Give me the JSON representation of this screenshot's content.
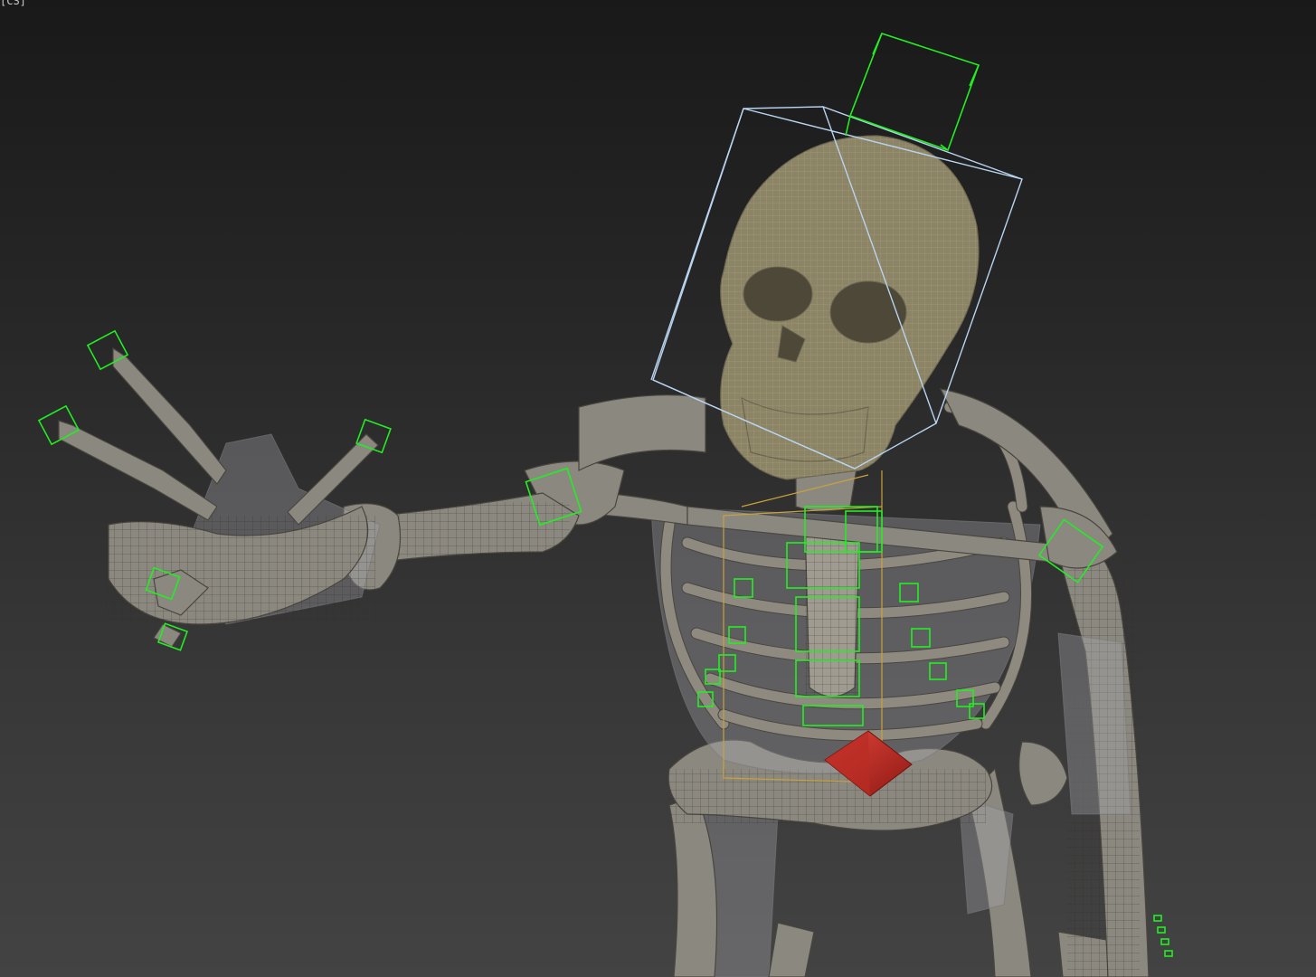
{
  "viewport": {
    "label": "[CS]",
    "background_top": "#191919",
    "background_bottom": "#434343"
  },
  "colors": {
    "bone": "#8b8880",
    "skull_mesh": "#8c8466",
    "control_box": "#22ee22",
    "selection_box": "#b8d4f0",
    "object_box": "#c8a23a",
    "root_marker": "#d43a30"
  },
  "scene": {
    "object": "skeleton-rig",
    "mode": "wireframe-on-shaded"
  }
}
